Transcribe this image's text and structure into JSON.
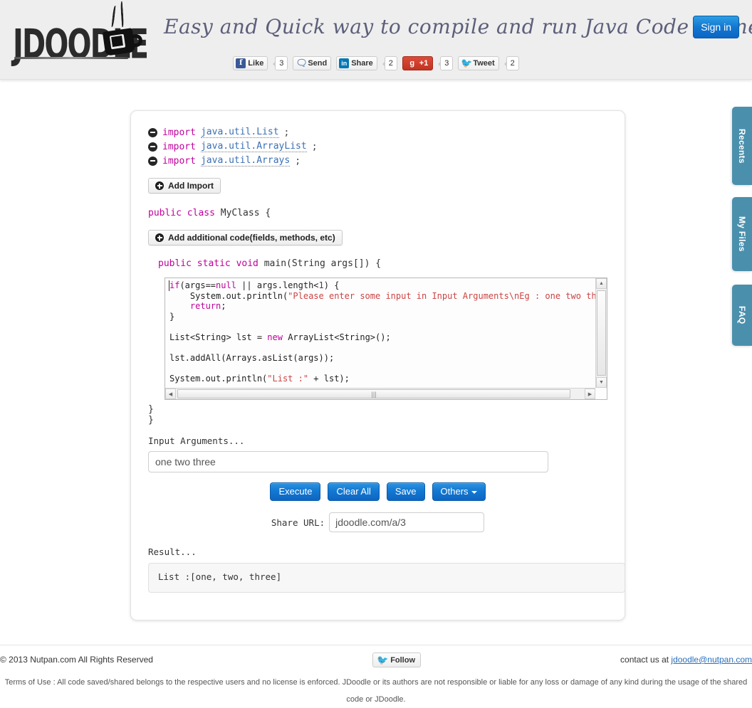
{
  "header": {
    "logo_text": "JDOODLE",
    "logo_icon": "coffee-cup-icon",
    "tagline": "Easy and Quick way to compile and run Java Code online",
    "signin_label": "Sign in",
    "social": [
      {
        "name": "facebook-like",
        "label": "Like",
        "count": "3",
        "icon": "facebook-icon"
      },
      {
        "name": "facebook-send",
        "label": "Send",
        "count": "",
        "icon": "send-icon"
      },
      {
        "name": "linkedin-share",
        "label": "Share",
        "count": "2",
        "icon": "linkedin-icon"
      },
      {
        "name": "google-plus",
        "label": "+1",
        "count": "3",
        "icon": "google-plus-icon"
      },
      {
        "name": "twitter-tweet",
        "label": "Tweet",
        "count": "2",
        "icon": "twitter-icon"
      }
    ]
  },
  "editor": {
    "imports": [
      {
        "keyword": "import",
        "package": "java.util.List",
        "semicolon": ";"
      },
      {
        "keyword": "import",
        "package": "java.util.ArrayList",
        "semicolon": ";"
      },
      {
        "keyword": "import",
        "package": "java.util.Arrays",
        "semicolon": ";"
      }
    ],
    "add_import_label": "Add Import",
    "class_declaration": {
      "modifier": "public class",
      "name": " MyClass {"
    },
    "add_code_label": "Add additional code(fields, methods, etc)",
    "main_signature": {
      "modifier": "public static void",
      "rest": " main(String args[]) {"
    },
    "code_lines": [
      "if(args==null || args.length<1) {",
      "    System.out.println(\"Please enter some input in Input Arguments\\nEg : one two three\");",
      "    return;",
      "}",
      "",
      "List<String> lst = new ArrayList<String>();",
      "",
      "lst.addAll(Arrays.asList(args));",
      "",
      "System.out.println(\"List :\" + lst);"
    ],
    "closing_brace_inner": "  }",
    "closing_brace_outer": "}"
  },
  "input_args": {
    "label": "Input Arguments...",
    "value": "one two three",
    "placeholder": ""
  },
  "actions": {
    "execute": "Execute",
    "clear_all": "Clear All",
    "save": "Save",
    "others": "Others"
  },
  "share": {
    "label": "Share URL:",
    "value": "jdoodle.com/a/3"
  },
  "result": {
    "label": "Result...",
    "output": "List :[one, two, three]"
  },
  "side_tabs": [
    {
      "label": "Recents"
    },
    {
      "label": "My Files"
    },
    {
      "label": "FAQ"
    }
  ],
  "footer": {
    "copyright": "© 2013 Nutpan.com All Rights Reserved",
    "follow_label": "Follow",
    "contact_prefix": "contact us at ",
    "contact_email": "jdoodle@nutpan.com",
    "terms": "Terms of Use : All code saved/shared belongs to the respective users and no license is enforced. JDoodle or its authors are not responsible or liable for any loss or damage of any kind during the usage of the shared code or JDoodle."
  },
  "colors": {
    "accent_blue": "#1378d2",
    "tab_blue": "#4a90ad",
    "keyword": "#c0009c",
    "package_link": "#3b6fb5",
    "string": "#cc4444"
  }
}
